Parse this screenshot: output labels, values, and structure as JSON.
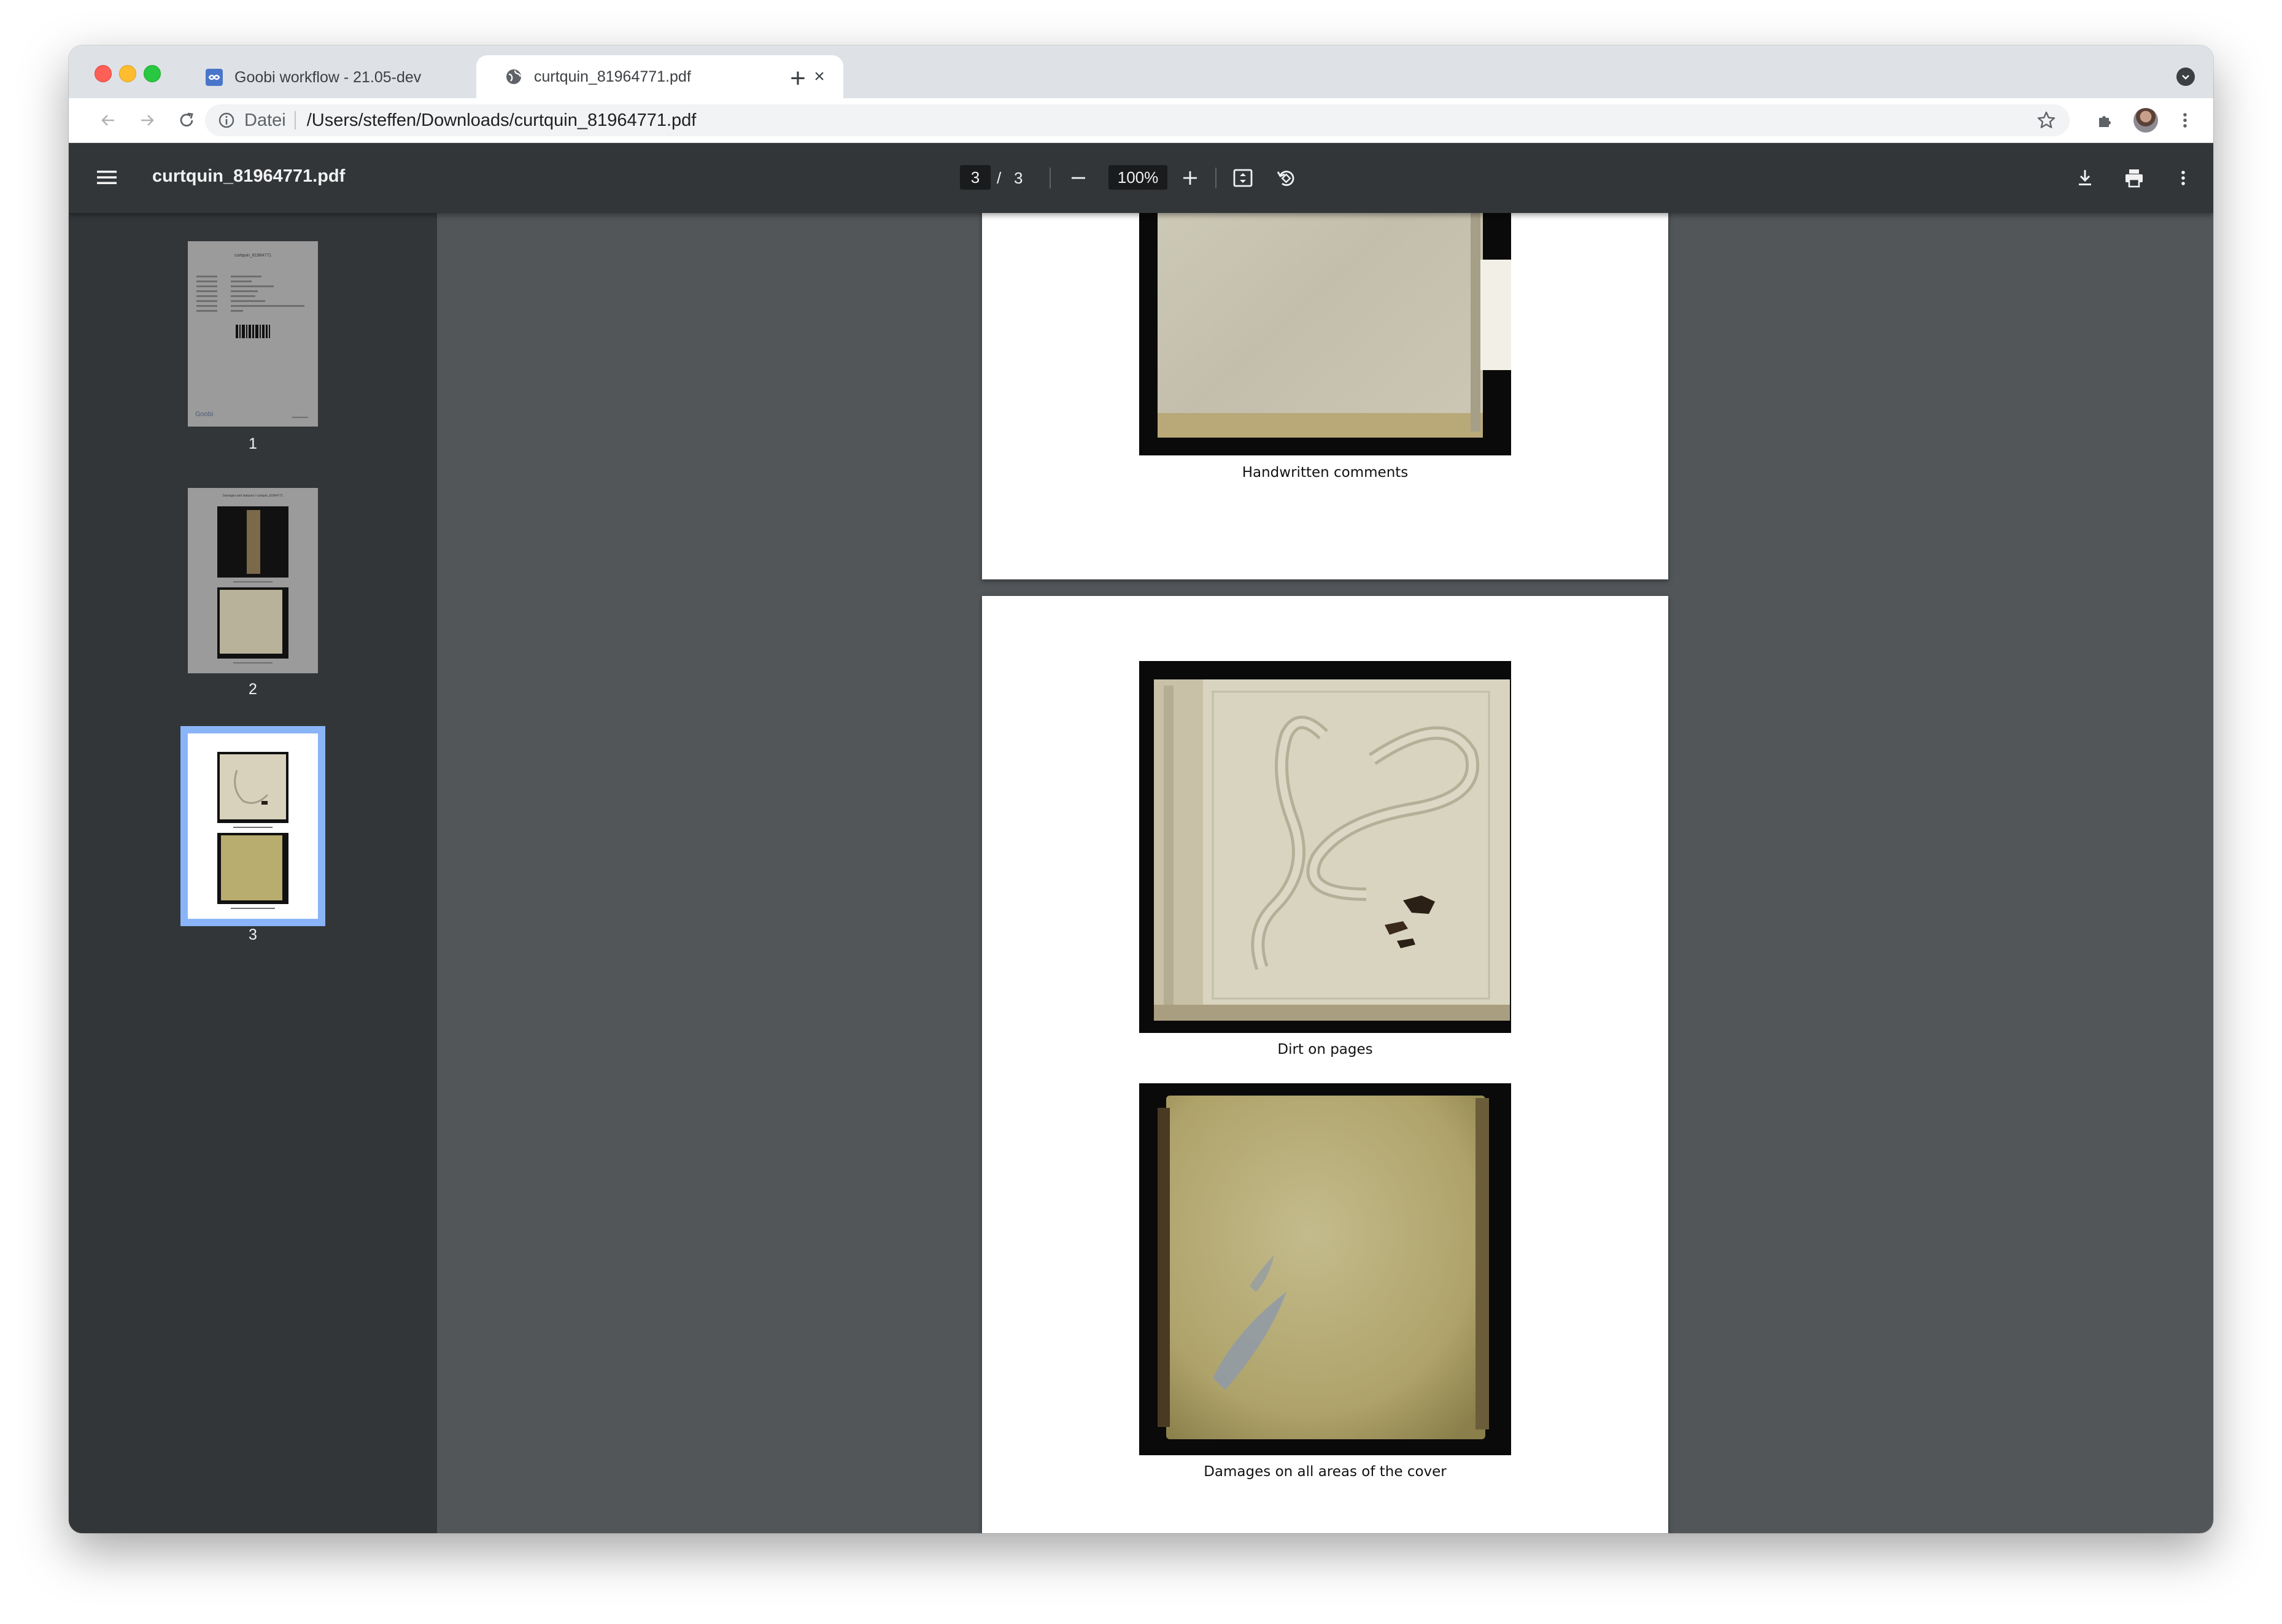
{
  "browser": {
    "tabs": [
      {
        "title": "Goobi workflow - 21.05-dev",
        "icon": "goobi-favicon-icon",
        "active": false
      },
      {
        "title": "curtquin_81964771.pdf",
        "icon": "globe-icon",
        "active": true
      }
    ],
    "address": {
      "scheme_label": "Datei",
      "path": "/Users/steffen/Downloads/curtquin_81964771.pdf"
    }
  },
  "pdf_viewer": {
    "filename": "curtquin_81964771.pdf",
    "current_page": "3",
    "page_separator": "/",
    "total_pages": "3",
    "zoom": "100%",
    "thumbnails": [
      {
        "label": "1",
        "selected": false
      },
      {
        "label": "2",
        "selected": false
      },
      {
        "label": "3",
        "selected": true
      }
    ],
    "captions": {
      "handwritten": "Handwritten comments",
      "dirt": "Dirt on pages",
      "damages": "Damages on all areas of the cover"
    },
    "thumb1": {
      "heading": "curtquin_81964771",
      "logo": "Goobi"
    },
    "thumb2": {
      "heading": "Damages and statuses / curtquin_81964771"
    }
  },
  "colors": {
    "tab_strip": "#dee1e6",
    "pdf_toolbar": "#323639",
    "viewer_bg": "#525659",
    "thumb_selected": "#8ab4f8"
  }
}
